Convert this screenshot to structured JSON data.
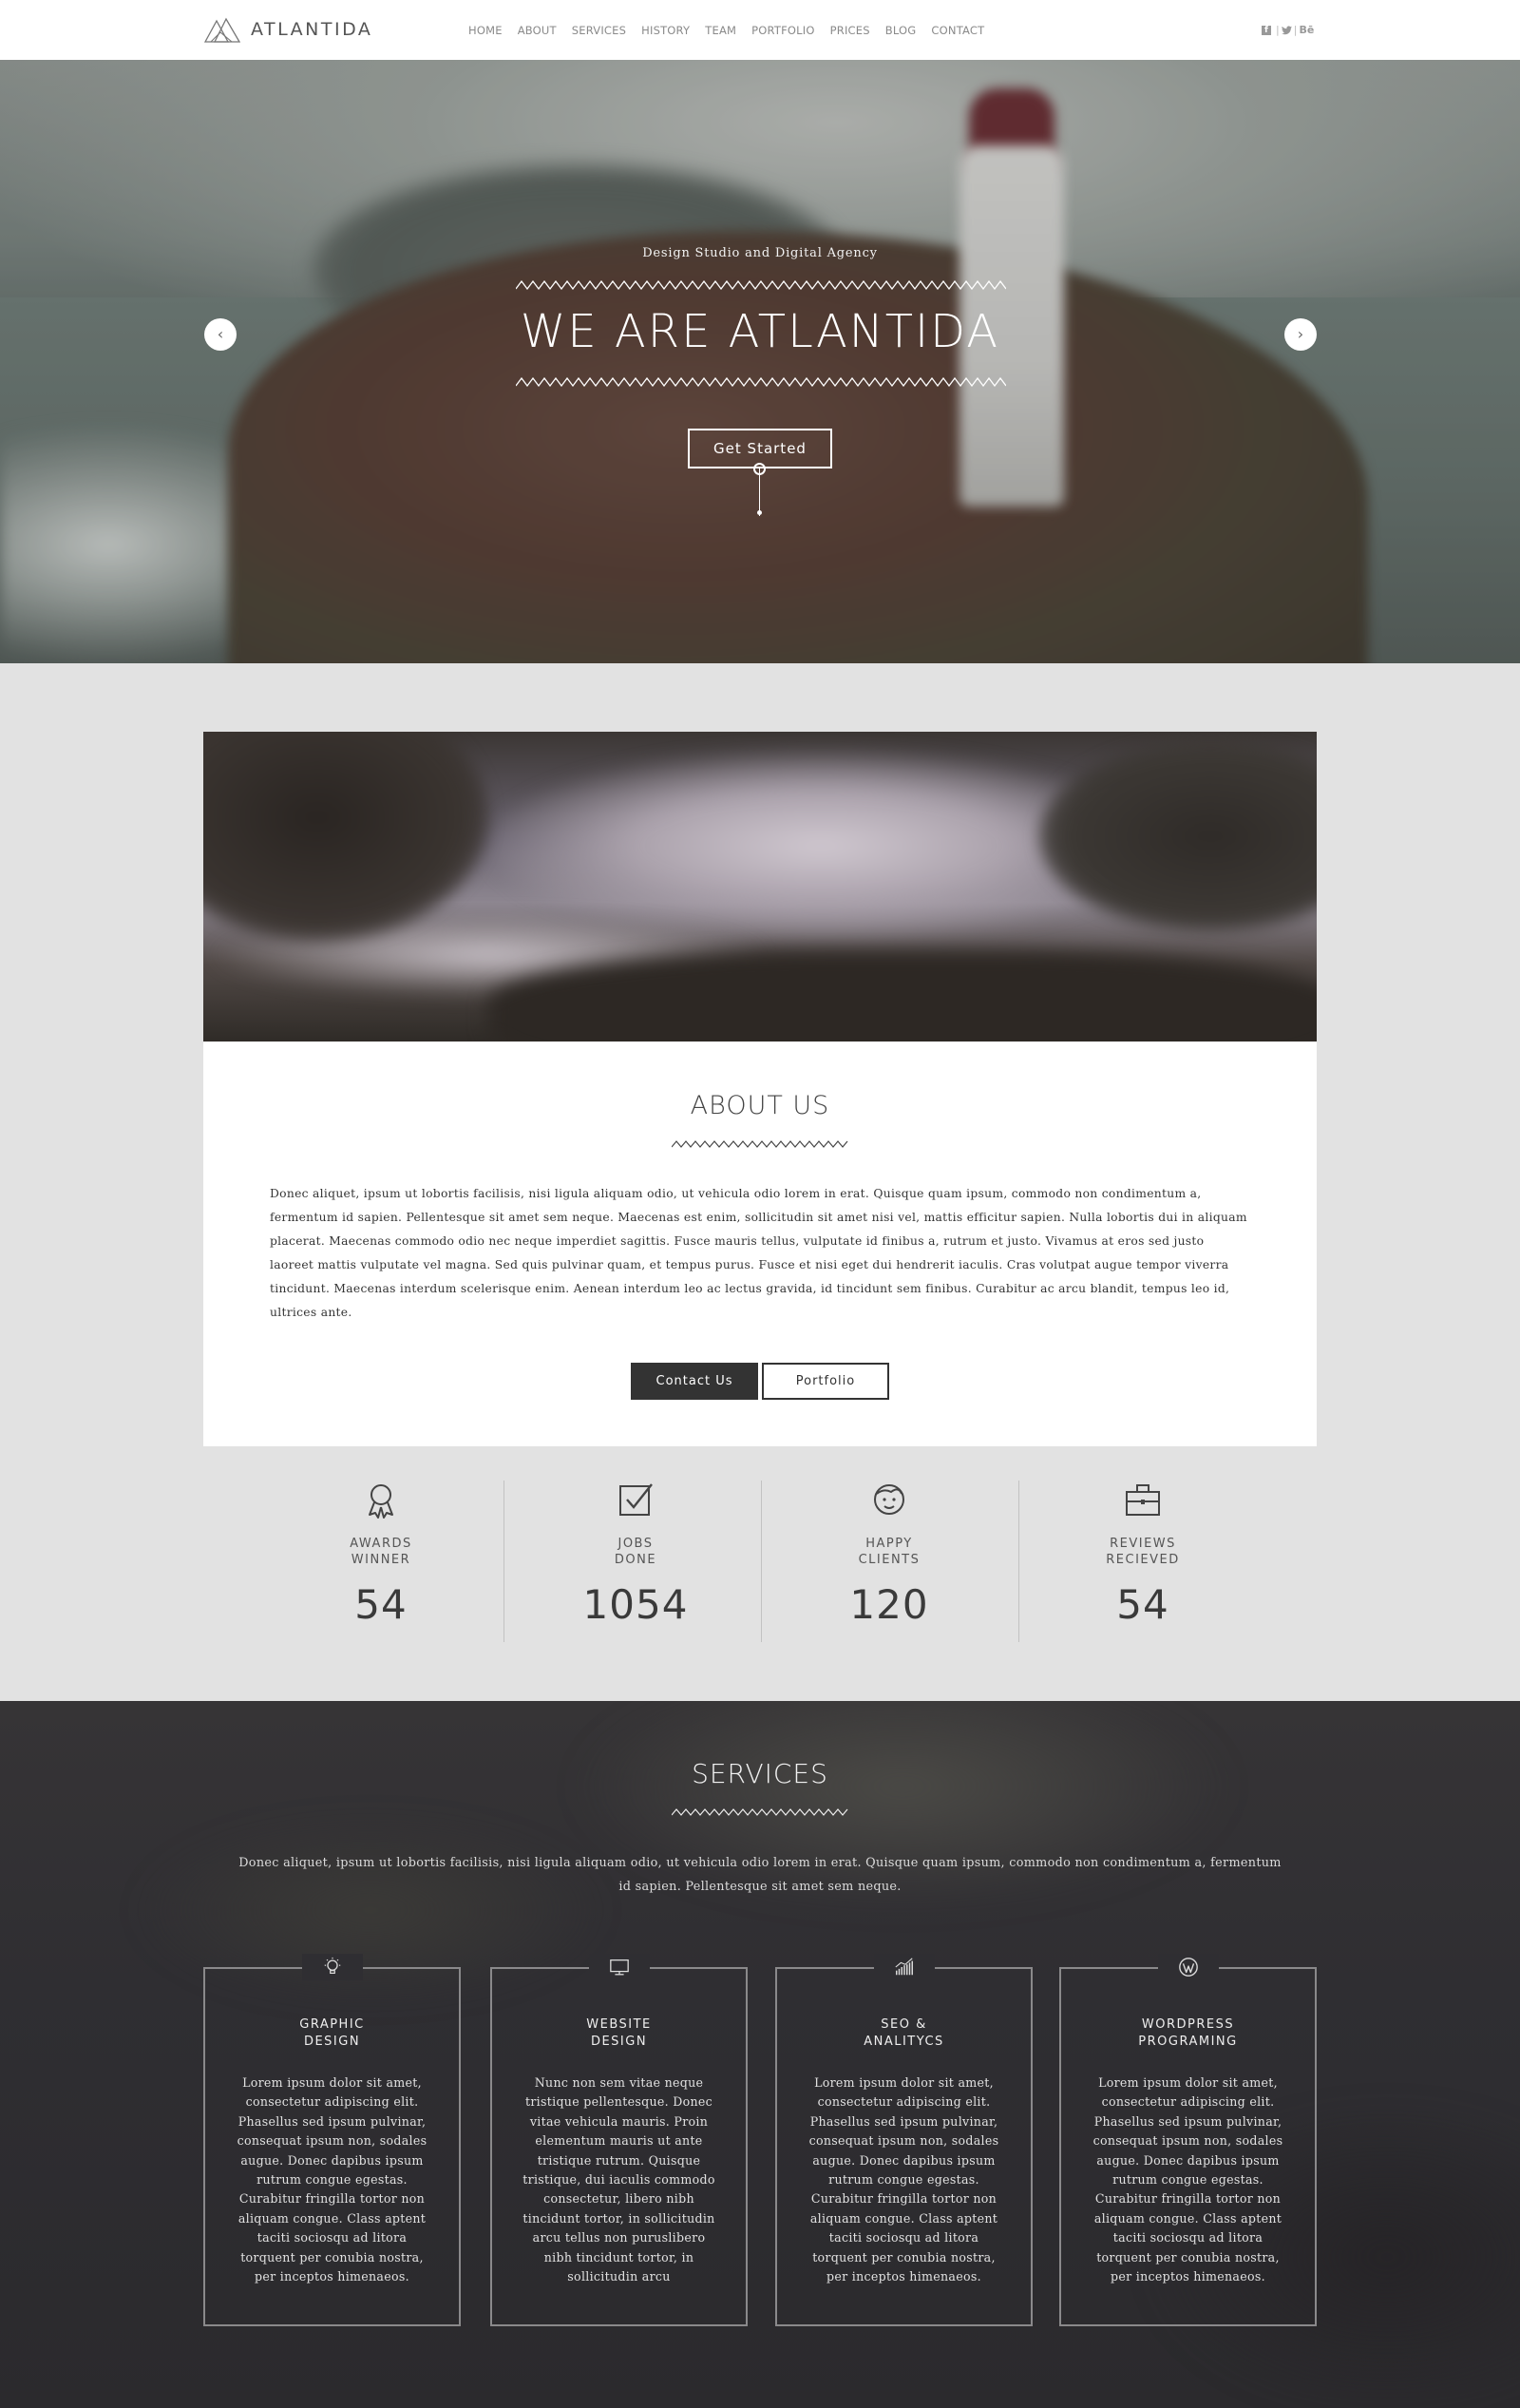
{
  "nav": {
    "brand": "ATLANTIDA",
    "menu": [
      "HOME",
      "ABOUT",
      "SERVICES",
      "HISTORY",
      "TEAM",
      "PORTFOLIO",
      "PRICES",
      "BLOG",
      "CONTACT"
    ],
    "social": [
      "facebook-icon",
      "twitter-icon",
      "behance-icon"
    ],
    "behance_label": "Bē"
  },
  "hero": {
    "subtitle": "Design Studio and Digital Agency",
    "title": "WE ARE ATLANTIDA",
    "cta": "Get Started",
    "prev": "‹",
    "next": "›"
  },
  "about": {
    "title": "ABOUT US",
    "text": "Donec aliquet, ipsum ut lobortis facilisis, nisi ligula aliquam odio, ut vehicula odio lorem in erat. Quisque quam ipsum, commodo non condimentum a, fermentum id sapien. Pellentesque sit amet sem neque. Maecenas est enim, sollicitudin sit amet nisi vel, mattis efficitur sapien. Nulla lobortis dui in aliquam placerat. Maecenas commodo odio nec neque imperdiet sagittis. Fusce mauris tellus, vulputate id finibus a, rutrum et justo. Vivamus at eros sed justo laoreet mattis vulputate vel magna. Sed quis pulvinar quam, et tempus purus. Fusce et nisi eget dui hendrerit iaculis. Cras volutpat augue tempor viverra tincidunt. Maecenas interdum scelerisque enim. Aenean interdum leo ac lectus gravida, id tincidunt sem finibus. Curabitur ac arcu blandit, tempus leo id, ultrices ante.",
    "contact_button": "Contact Us",
    "portfolio_button": "Portfolio"
  },
  "stats": [
    {
      "icon": "award-icon",
      "label": "AWARDS\nWINNER",
      "value": "54"
    },
    {
      "icon": "checkbox-icon",
      "label": "JOBS\nDONE",
      "value": "1054"
    },
    {
      "icon": "face-icon",
      "label": "HAPPY\nCLIENTS",
      "value": "120"
    },
    {
      "icon": "briefcase-icon",
      "label": "REVIEWS\nRECIEVED",
      "value": "54"
    }
  ],
  "services": {
    "title": "SERVICES",
    "text": "Donec aliquet, ipsum ut lobortis facilisis, nisi ligula aliquam odio, ut vehicula odio lorem in erat. Quisque quam ipsum, commodo non condimentum a, fermentum id sapien. Pellentesque sit amet sem neque.",
    "cards": [
      {
        "icon": "lightbulb-icon",
        "title": "GRAPHIC\nDESIGN",
        "text": "Lorem ipsum dolor sit amet, consectetur adipiscing elit. Phasellus sed ipsum pulvinar, consequat ipsum non, sodales augue. Donec dapibus ipsum rutrum congue egestas. Curabitur fringilla tortor non aliquam congue. Class aptent taciti sociosqu ad litora torquent per conubia nostra, per inceptos himenaeos."
      },
      {
        "icon": "monitor-icon",
        "title": "WEBSITE\nDESIGN",
        "text": "Nunc non sem vitae neque tristique pellentesque. Donec vitae vehicula mauris. Proin elementum mauris ut ante tristique rutrum. Quisque tristique, dui iaculis commodo consectetur, libero nibh tincidunt tortor, in sollicitudin arcu tellus non puruslibero nibh tincidunt tortor, in sollicitudin arcu"
      },
      {
        "icon": "bar-chart-icon",
        "title": "SEO &\nANALITYCS",
        "text": "Lorem ipsum dolor sit amet, consectetur adipiscing elit. Phasellus sed ipsum pulvinar, consequat ipsum non, sodales augue. Donec dapibus ipsum rutrum congue egestas. Curabitur fringilla tortor non aliquam congue. Class aptent taciti sociosqu ad litora torquent per conubia nostra, per inceptos himenaeos."
      },
      {
        "icon": "wordpress-icon",
        "title": "WORDPRESS\nPROGRAMING",
        "text": "Lorem ipsum dolor sit amet, consectetur adipiscing elit. Phasellus sed ipsum pulvinar, consequat ipsum non, sodales augue. Donec dapibus ipsum rutrum congue egestas. Curabitur fringilla tortor non aliquam congue. Class aptent taciti sociosqu ad litora torquent per conubia nostra, per inceptos himenaeos."
      }
    ]
  },
  "colors": {
    "dark_button": "#333333",
    "page_bg": "#e2e2e2",
    "services_bg": "#2f2e32"
  }
}
